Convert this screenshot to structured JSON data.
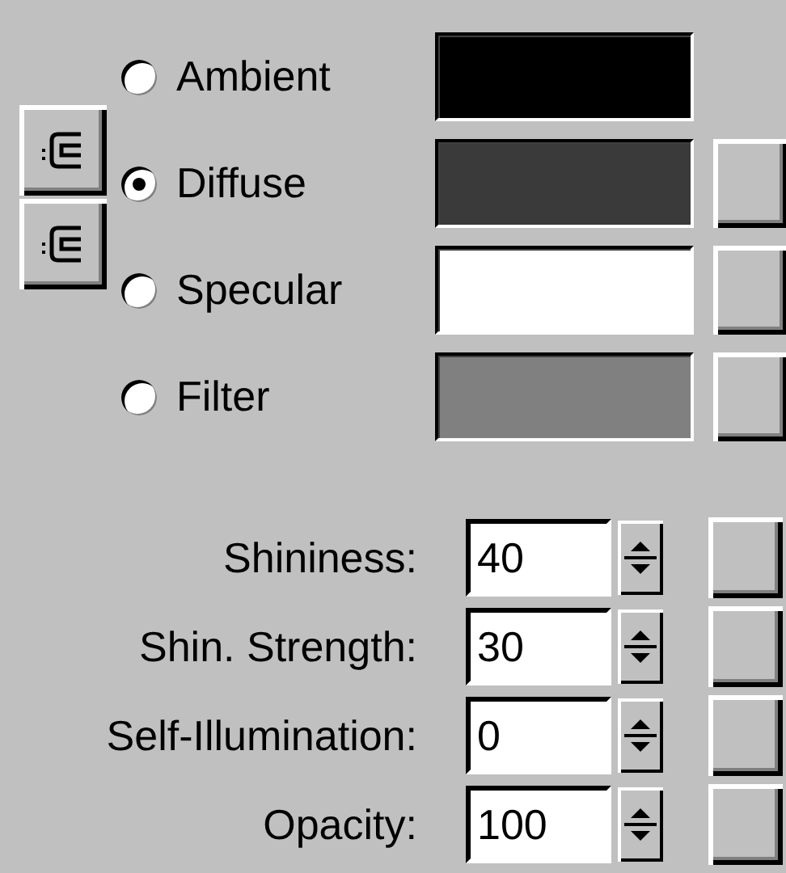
{
  "lock_buttons": [
    {
      "kind": "lock"
    },
    {
      "kind": "lock"
    }
  ],
  "color_channels": [
    {
      "label": "Ambient",
      "selected": false,
      "color": "#000000",
      "map_button": false
    },
    {
      "label": "Diffuse",
      "selected": true,
      "color": "#3a3a3a",
      "map_button": true
    },
    {
      "label": "Specular",
      "selected": false,
      "color": "#ffffff",
      "map_button": true
    },
    {
      "label": "Filter",
      "selected": false,
      "color": "#808080",
      "map_button": true
    }
  ],
  "parameters": [
    {
      "label": "Shininess:",
      "value": "40"
    },
    {
      "label": "Shin. Strength:",
      "value": "30"
    },
    {
      "label": "Self-Illumination:",
      "value": "0"
    },
    {
      "label": "Opacity:",
      "value": "100"
    }
  ]
}
